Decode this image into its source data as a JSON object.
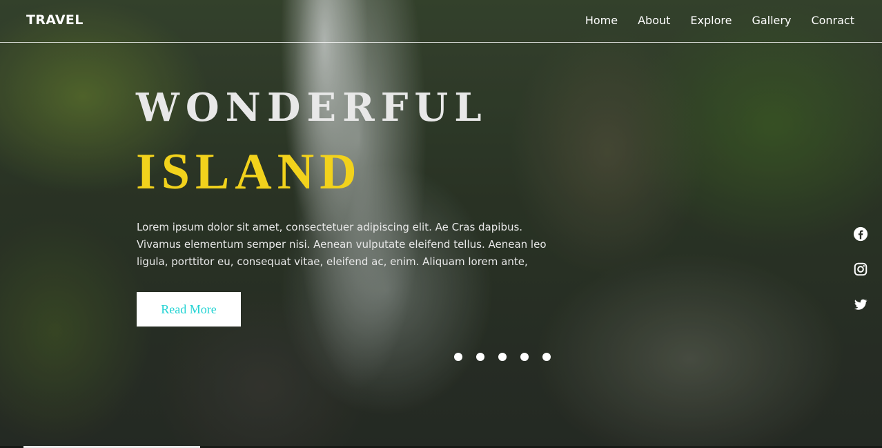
{
  "brand": "TRAVEL",
  "nav": {
    "items": [
      {
        "label": "Home"
      },
      {
        "label": "About"
      },
      {
        "label": "Explore"
      },
      {
        "label": "Gallery"
      },
      {
        "label": "Conract"
      }
    ]
  },
  "hero": {
    "line1": "WONDERFUL",
    "line2": "ISLAND",
    "description": "Lorem ipsum dolor sit amet, consectetuer adipiscing elit. Ae Cras dapibus. Vivamus elementum semper nisi. Aenean vulputate eleifend tellus. Aenean leo ligula, porttitor eu, consequat vitae, eleifend ac, enim. Aliquam lorem ante,",
    "button_label": "Read More"
  },
  "slider": {
    "dot_count": 5
  },
  "social": [
    {
      "icon": "facebook-icon"
    },
    {
      "icon": "instagram-icon"
    },
    {
      "icon": "twitter-icon"
    }
  ],
  "progress": {
    "fraction": 0.2
  },
  "colors": {
    "accent_yellow": "#f2d21c",
    "button_text_cyan": "#22d3d3",
    "text_white": "#ffffff"
  }
}
